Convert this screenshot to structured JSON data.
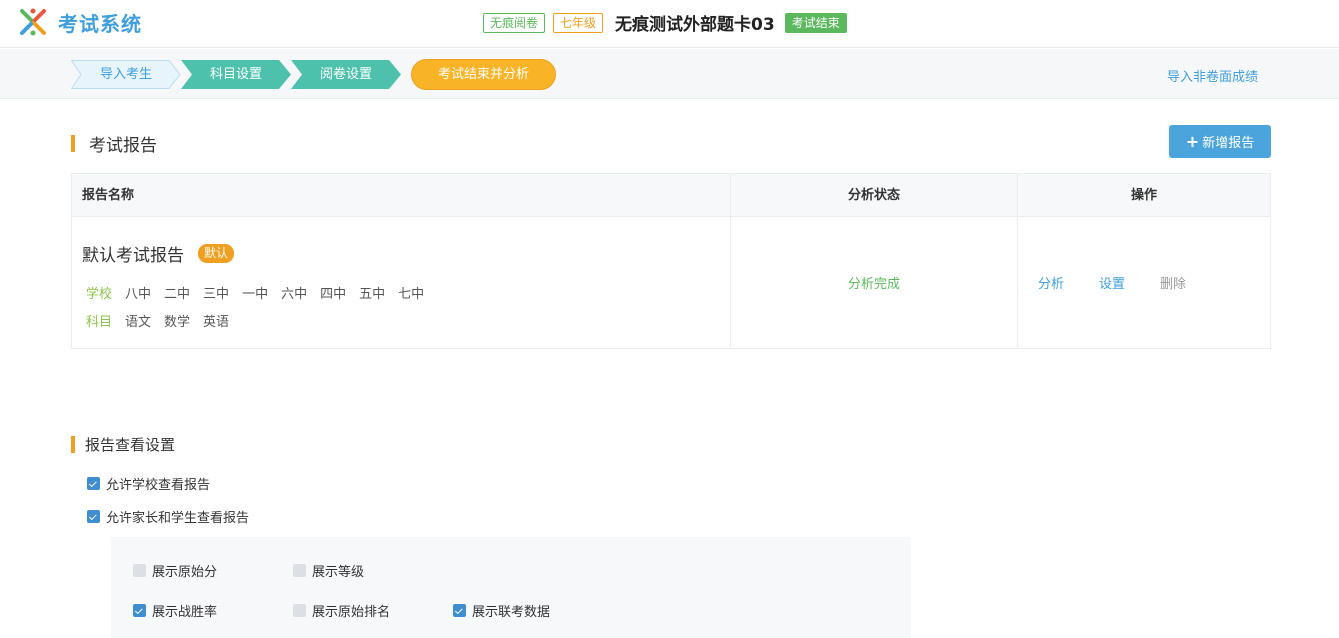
{
  "header": {
    "app_title": "考试系统",
    "tags": [
      "无痕阅卷",
      "七年级"
    ],
    "exam_title": "无痕测试外部题卡03",
    "status": "考试结束",
    "colors": {
      "brand": "#3e9fdc",
      "green": "#5cb85c",
      "orange": "#f0a020"
    }
  },
  "steps": {
    "items": [
      "导入考生",
      "科目设置",
      "阅卷设置"
    ],
    "current": "考试结束并分析",
    "import_link": "导入非卷面成绩"
  },
  "reports": {
    "section_title": "考试报告",
    "add_button": "新增报告",
    "columns": [
      "报告名称",
      "分析状态",
      "操作"
    ],
    "rows": [
      {
        "name": "默认考试报告",
        "badge": "默认",
        "school_label": "学校",
        "schools": [
          "八中",
          "二中",
          "三中",
          "一中",
          "六中",
          "四中",
          "五中",
          "七中"
        ],
        "subject_label": "科目",
        "subjects": [
          "语文",
          "数学",
          "英语"
        ],
        "status": "分析完成",
        "actions": [
          "分析",
          "设置",
          "删除"
        ]
      }
    ]
  },
  "settings": {
    "section_title": "报告查看设置",
    "allow_school": {
      "label": "允许学校查看报告",
      "checked": true
    },
    "allow_parent": {
      "label": "允许家长和学生查看报告",
      "checked": true
    },
    "options": [
      {
        "label": "展示原始分",
        "checked": false
      },
      {
        "label": "展示等级",
        "checked": false
      },
      {
        "label": "展示战胜率",
        "checked": true
      },
      {
        "label": "展示原始排名",
        "checked": false
      },
      {
        "label": "展示联考数据",
        "checked": true
      }
    ]
  }
}
